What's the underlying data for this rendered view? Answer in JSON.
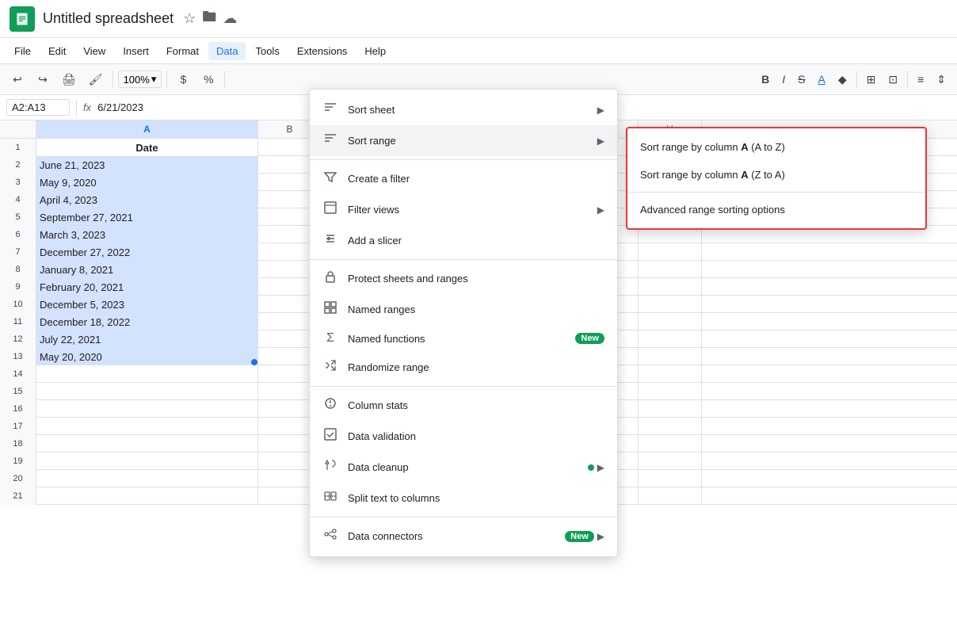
{
  "app": {
    "title": "Untitled spreadsheet",
    "logo_color": "#0f9d58"
  },
  "menu_bar": {
    "items": [
      "File",
      "Edit",
      "View",
      "Insert",
      "Format",
      "Data",
      "Tools",
      "Extensions",
      "Help"
    ]
  },
  "toolbar": {
    "zoom": "100%",
    "currency": "$",
    "percent": "%"
  },
  "formula_bar": {
    "cell_ref": "A2:A13",
    "fx_label": "fx",
    "formula": "6/21/2023"
  },
  "spreadsheet": {
    "col_a_header": "A",
    "col_b_header": "B",
    "header_row": "Date",
    "rows": [
      {
        "num": 1,
        "a": "Date",
        "is_header": true
      },
      {
        "num": 2,
        "a": "June 21, 2023",
        "selected": true
      },
      {
        "num": 3,
        "a": "May 9, 2020",
        "selected": true
      },
      {
        "num": 4,
        "a": "April 4, 2023",
        "selected": true
      },
      {
        "num": 5,
        "a": "September 27, 2021",
        "selected": true
      },
      {
        "num": 6,
        "a": "March 3, 2023",
        "selected": true
      },
      {
        "num": 7,
        "a": "December 27, 2022",
        "selected": true
      },
      {
        "num": 8,
        "a": "January 8, 2021",
        "selected": true
      },
      {
        "num": 9,
        "a": "February 20, 2021",
        "selected": true
      },
      {
        "num": 10,
        "a": "December 5, 2023",
        "selected": true
      },
      {
        "num": 11,
        "a": "December 18, 2022",
        "selected": true
      },
      {
        "num": 12,
        "a": "July 22, 2021",
        "selected": true
      },
      {
        "num": 13,
        "a": "May 20, 2020",
        "selected": true
      },
      {
        "num": 14,
        "a": "",
        "selected": false
      },
      {
        "num": 15,
        "a": "",
        "selected": false
      },
      {
        "num": 16,
        "a": "",
        "selected": false
      },
      {
        "num": 17,
        "a": "",
        "selected": false
      },
      {
        "num": 18,
        "a": "",
        "selected": false
      },
      {
        "num": 19,
        "a": "",
        "selected": false
      },
      {
        "num": 20,
        "a": "",
        "selected": false
      },
      {
        "num": 21,
        "a": "",
        "selected": false
      }
    ]
  },
  "data_menu": {
    "items": [
      {
        "id": "sort-sheet",
        "icon": "sort",
        "label": "Sort sheet",
        "arrow": true
      },
      {
        "id": "sort-range",
        "icon": "sort",
        "label": "Sort range",
        "arrow": true
      },
      {
        "id": "sep1"
      },
      {
        "id": "create-filter",
        "icon": "filter",
        "label": "Create a filter"
      },
      {
        "id": "filter-views",
        "icon": "filter-views",
        "label": "Filter views",
        "arrow": true
      },
      {
        "id": "add-slicer",
        "icon": "slicer",
        "label": "Add a slicer"
      },
      {
        "id": "sep2"
      },
      {
        "id": "protect",
        "icon": "lock",
        "label": "Protect sheets and ranges"
      },
      {
        "id": "named-ranges",
        "icon": "grid",
        "label": "Named ranges"
      },
      {
        "id": "named-functions",
        "icon": "sigma",
        "label": "Named functions",
        "badge": "New"
      },
      {
        "id": "randomize",
        "icon": "random",
        "label": "Randomize range"
      },
      {
        "id": "sep3"
      },
      {
        "id": "column-stats",
        "icon": "stats",
        "label": "Column stats"
      },
      {
        "id": "data-validation",
        "icon": "validation",
        "label": "Data validation"
      },
      {
        "id": "data-cleanup",
        "icon": "cleanup",
        "label": "Data cleanup",
        "dot": true,
        "arrow": true
      },
      {
        "id": "split-text",
        "icon": "split",
        "label": "Split text to columns"
      },
      {
        "id": "sep4"
      },
      {
        "id": "data-connectors",
        "icon": "connector",
        "label": "Data connectors",
        "badge": "New",
        "arrow": true
      }
    ]
  },
  "sort_submenu": {
    "items": [
      {
        "id": "sort-a-z",
        "label": "Sort range by column A (A to Z)"
      },
      {
        "id": "sort-z-a",
        "label": "Sort range by column A (Z to A)"
      },
      {
        "id": "sep"
      },
      {
        "id": "advanced",
        "label": "Advanced range sorting options"
      }
    ]
  }
}
